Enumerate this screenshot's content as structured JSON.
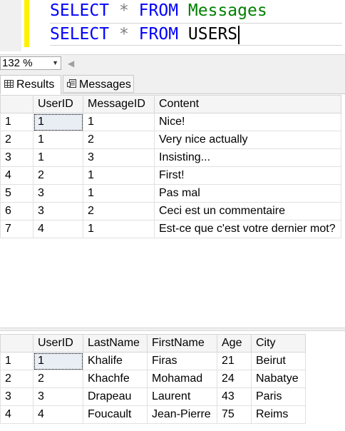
{
  "editor": {
    "line1": {
      "select": "SELECT",
      "star": "*",
      "from": "FROM",
      "table": "Messages"
    },
    "line2": {
      "select": "SELECT",
      "star": "*",
      "from": "FROM",
      "table": "USERS"
    }
  },
  "zoom": {
    "value": "132 %"
  },
  "tabs": [
    {
      "label": "Results"
    },
    {
      "label": "Messages"
    }
  ],
  "grid1": {
    "columns": [
      "UserID",
      "MessageID",
      "Content"
    ],
    "rows": [
      {
        "num": "1",
        "cells": [
          "1",
          "1",
          "Nice!"
        ]
      },
      {
        "num": "2",
        "cells": [
          "1",
          "2",
          "Very nice actually"
        ]
      },
      {
        "num": "3",
        "cells": [
          "1",
          "3",
          "Insisting..."
        ]
      },
      {
        "num": "4",
        "cells": [
          "2",
          "1",
          "First!"
        ]
      },
      {
        "num": "5",
        "cells": [
          "3",
          "1",
          "Pas mal"
        ]
      },
      {
        "num": "6",
        "cells": [
          "3",
          "2",
          "Ceci est un commentaire"
        ]
      },
      {
        "num": "7",
        "cells": [
          "4",
          "1",
          "Est-ce que c'est votre dernier mot?"
        ]
      }
    ]
  },
  "grid2": {
    "columns": [
      "UserID",
      "LastName",
      "FirstName",
      "Age",
      "City"
    ],
    "rows": [
      {
        "num": "1",
        "cells": [
          "1",
          "Khalife",
          "Firas",
          "21",
          "Beirut"
        ]
      },
      {
        "num": "2",
        "cells": [
          "2",
          "Khachfe",
          "Mohamad",
          "24",
          "Nabatye"
        ]
      },
      {
        "num": "3",
        "cells": [
          "3",
          "Drapeau",
          "Laurent",
          "43",
          "Paris"
        ]
      },
      {
        "num": "4",
        "cells": [
          "4",
          "Foucault",
          "Jean-Pierre",
          "75",
          "Reims"
        ]
      }
    ]
  }
}
